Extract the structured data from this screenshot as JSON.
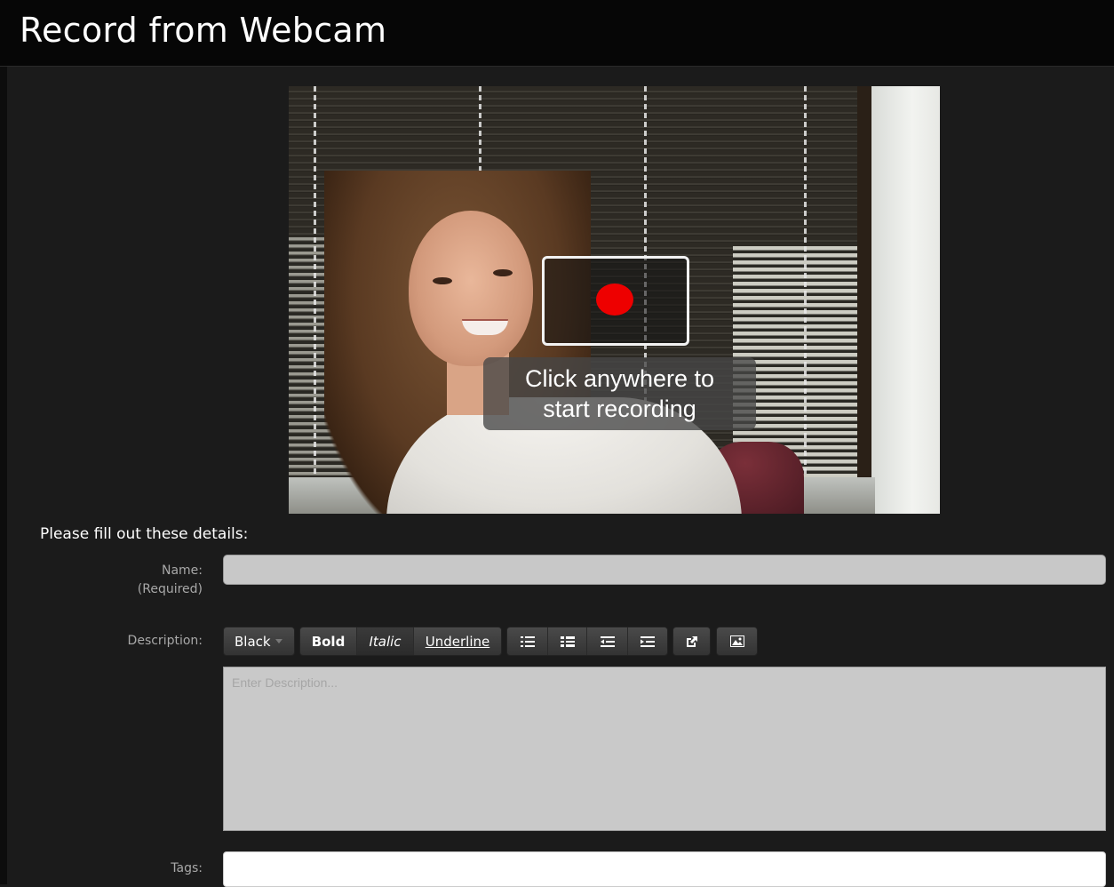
{
  "header": {
    "title": "Record from Webcam"
  },
  "webcam": {
    "record_icon": "record-dot-icon",
    "caption_line1": "Click anywhere to",
    "caption_line2": "start recording",
    "record_color": "#ee0000"
  },
  "form": {
    "heading": "Please fill out these details:",
    "name": {
      "label": "Name:",
      "sublabel": "(Required)",
      "value": ""
    },
    "description": {
      "label": "Description:",
      "placeholder": "Enter Description...",
      "toolbar": {
        "color_label": "Black",
        "bold_label": "Bold",
        "italic_label": "Italic",
        "underline_label": "Underline",
        "list_icons": [
          "bulleted-list-icon",
          "numbered-list-icon",
          "outdent-icon",
          "indent-icon"
        ],
        "link_icon": "insert-link-icon",
        "image_icon": "insert-image-icon"
      }
    },
    "tags": {
      "label": "Tags:",
      "value": ""
    }
  }
}
